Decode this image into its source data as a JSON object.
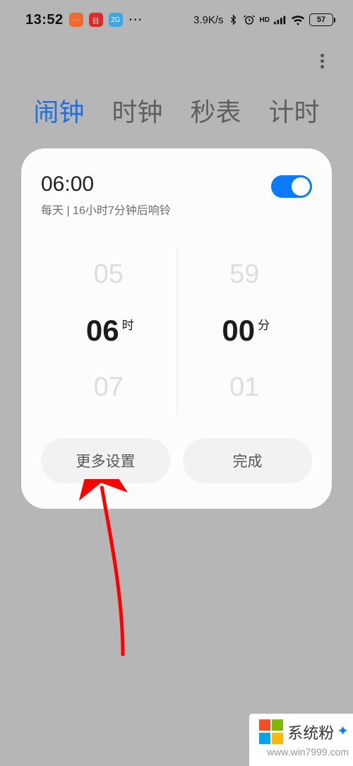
{
  "statusbar": {
    "time": "13:52",
    "net_speed": "3.9K/s",
    "battery_percent": "57"
  },
  "tabs": [
    {
      "label": "闹钟",
      "active": true
    },
    {
      "label": "时钟",
      "active": false
    },
    {
      "label": "秒表",
      "active": false
    },
    {
      "label": "计时",
      "active": false
    }
  ],
  "alarm": {
    "time": "06:00",
    "subtitle": "每天 | 16小时7分钟后响铃",
    "enabled": true,
    "hour": {
      "prev": "05",
      "cur": "06",
      "next": "07",
      "unit": "时"
    },
    "minute": {
      "prev": "59",
      "cur": "00",
      "next": "01",
      "unit": "分"
    }
  },
  "actions": {
    "more": "更多设置",
    "done": "完成"
  },
  "watermark": {
    "title_a": "系统粉",
    "url": "www.win7999.com",
    "colors": {
      "a": "#f25022",
      "b": "#7fba00",
      "c": "#00a4ef",
      "d": "#ffb900"
    }
  }
}
